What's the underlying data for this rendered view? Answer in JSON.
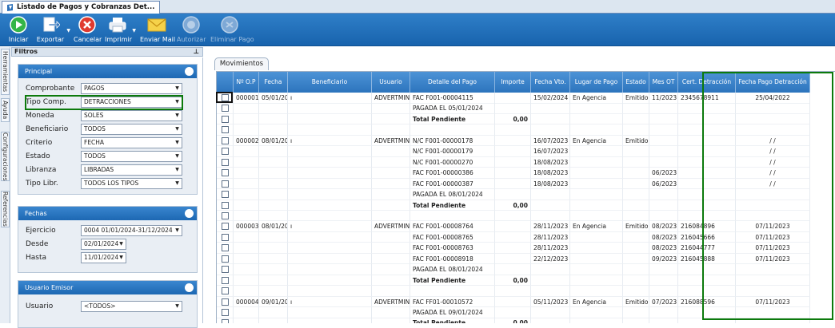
{
  "tab": {
    "title": "Listado de Pagos y Cobranzas Det..."
  },
  "toolbar": {
    "iniciar": "Iniciar",
    "exportar": "Exportar",
    "cancelar": "Cancelar",
    "imprimir": "Imprimir",
    "enviar_mail": "Enviar Mail",
    "autorizar": "Autorizar",
    "eliminar_pago": "Eliminar Pago"
  },
  "filtros": {
    "title": "Filtros"
  },
  "side_tabs": [
    "Herramientas",
    "Ayuda",
    "Configuraciones",
    "Referencias"
  ],
  "principal": {
    "title": "Principal",
    "fields": [
      {
        "label": "Comprobante",
        "value": "PAGOS"
      },
      {
        "label": "Tipo Comp.",
        "value": "DETRACCIONES"
      },
      {
        "label": "Moneda",
        "value": "SOLES"
      },
      {
        "label": "Beneficiario",
        "value": "TODOS"
      },
      {
        "label": "Criterio",
        "value": "FECHA"
      },
      {
        "label": "Estado",
        "value": "TODOS"
      },
      {
        "label": "Libranza",
        "value": "LIBRADAS"
      },
      {
        "label": "Tipo Libr.",
        "value": "TODOS LOS TIPOS"
      }
    ]
  },
  "fechas": {
    "title": "Fechas",
    "ejercicio_label": "Ejercicio",
    "ejercicio_value": "0004 01/01/2024-31/12/2024",
    "desde_label": "Desde",
    "desde_value": "02/01/2024",
    "hasta_label": "Hasta",
    "hasta_value": "11/01/2024"
  },
  "usuario_emisor": {
    "title": "Usuario Emisor",
    "label": "Usuario",
    "value": "<TODOS>"
  },
  "movimientos": {
    "tab": "Movimientos"
  },
  "grid": {
    "columns": [
      "Nº O.P",
      "Fecha",
      "Beneficiario",
      "Usuario",
      "Detalle del Pago",
      "Importe",
      "Fecha Vto.",
      "Lugar de Pago",
      "Estado",
      "Mes OT",
      "Cert. Detracción",
      "Fecha Pago Detracción"
    ],
    "rows": [
      [
        "000001",
        "05/01/2024",
        "ı",
        "ADVERTMIND",
        "FAC F001-00004115",
        "",
        "15/02/2024",
        "En Agencia",
        "Emitido",
        "11/2023",
        "2345678911",
        "25/04/2022"
      ],
      [
        "",
        "",
        "",
        "",
        "PAGADA EL 05/01/2024",
        "",
        "",
        "",
        "",
        "",
        "",
        ""
      ],
      [
        "",
        "",
        "",
        "",
        "Total Pendiente",
        "0,00",
        "",
        "",
        "",
        "",
        "",
        ""
      ],
      [
        "",
        "",
        "",
        "",
        "",
        "",
        "",
        "",
        "",
        "",
        "",
        ""
      ],
      [
        "000002",
        "08/01/2024",
        "ı",
        "ADVERTMIND",
        "N/C F001-00000178",
        "",
        "16/07/2023",
        "En Agencia",
        "Emitido",
        "",
        "",
        "/ /"
      ],
      [
        "",
        "",
        "",
        "",
        "N/C F001-00000179",
        "",
        "16/07/2023",
        "",
        "",
        "",
        "",
        "/ /"
      ],
      [
        "",
        "",
        "",
        "",
        "N/C F001-00000270",
        "",
        "18/08/2023",
        "",
        "",
        "",
        "",
        "/ /"
      ],
      [
        "",
        "",
        "",
        "",
        "FAC F001-00000386",
        "",
        "18/08/2023",
        "",
        "",
        "06/2023",
        "",
        "/ /"
      ],
      [
        "",
        "",
        "",
        "",
        "FAC F001-00000387",
        "",
        "18/08/2023",
        "",
        "",
        "06/2023",
        "",
        "/ /"
      ],
      [
        "",
        "",
        "",
        "",
        "PAGADA EL 08/01/2024",
        "",
        "",
        "",
        "",
        "",
        "",
        ""
      ],
      [
        "",
        "",
        "",
        "",
        "Total Pendiente",
        "0,00",
        "",
        "",
        "",
        "",
        "",
        ""
      ],
      [
        "",
        "",
        "",
        "",
        "",
        "",
        "",
        "",
        "",
        "",
        "",
        ""
      ],
      [
        "000003",
        "08/01/2024",
        "ı",
        "ADVERTMIND",
        "FAC F001-00008764",
        "",
        "28/11/2023",
        "En Agencia",
        "Emitido",
        "08/2023",
        "216084896",
        "07/11/2023"
      ],
      [
        "",
        "",
        "",
        "",
        "FAC F001-00008765",
        "",
        "28/11/2023",
        "",
        "",
        "08/2023",
        "216045666",
        "07/11/2023"
      ],
      [
        "",
        "",
        "",
        "",
        "FAC F001-00008763",
        "",
        "28/11/2023",
        "",
        "",
        "08/2023",
        "216044777",
        "07/11/2023"
      ],
      [
        "",
        "",
        "",
        "",
        "FAC F001-00008918",
        "",
        "22/12/2023",
        "",
        "",
        "09/2023",
        "216045888",
        "07/11/2023"
      ],
      [
        "",
        "",
        "",
        "",
        "PAGADA EL 08/01/2024",
        "",
        "",
        "",
        "",
        "",
        "",
        ""
      ],
      [
        "",
        "",
        "",
        "",
        "Total Pendiente",
        "0,00",
        "",
        "",
        "",
        "",
        "",
        ""
      ],
      [
        "",
        "",
        "",
        "",
        "",
        "",
        "",
        "",
        "",
        "",
        "",
        ""
      ],
      [
        "000004",
        "09/01/2024",
        "ı",
        "ADVERTMIND",
        "FAC FF01-00010572",
        "",
        "05/11/2023",
        "En Agencia",
        "Emitido",
        "07/2023",
        "216088596",
        "07/11/2023"
      ],
      [
        "",
        "",
        "",
        "",
        "PAGADA EL 09/01/2024",
        "",
        "",
        "",
        "",
        "",
        "",
        ""
      ],
      [
        "",
        "",
        "",
        "",
        "Total Pendiente",
        "0,00",
        "",
        "",
        "",
        "",
        "",
        ""
      ]
    ]
  }
}
